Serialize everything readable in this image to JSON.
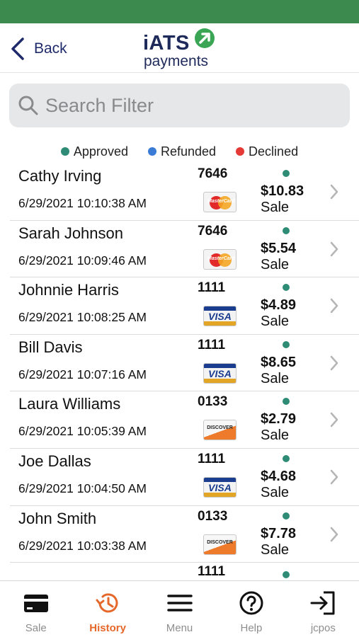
{
  "nav": {
    "back_label": "Back",
    "logo_line1": "iATS",
    "logo_line2": "payments"
  },
  "search": {
    "placeholder": "Search Filter"
  },
  "legend": [
    {
      "label": "Approved",
      "color": "#2e8b76"
    },
    {
      "label": "Refunded",
      "color": "#3a7bd5"
    },
    {
      "label": "Declined",
      "color": "#e53935"
    }
  ],
  "transactions": [
    {
      "name": "Cathy Irving",
      "date": "6/29/2021 10:10:38 AM",
      "last4": "7646",
      "card": "mastercard",
      "card_text": "MasterCard",
      "status": "approved",
      "amount": "$10.83",
      "type": "Sale"
    },
    {
      "name": "Sarah Johnson",
      "date": "6/29/2021 10:09:46 AM",
      "last4": "7646",
      "card": "mastercard",
      "card_text": "MasterCard",
      "status": "approved",
      "amount": "$5.54",
      "type": "Sale"
    },
    {
      "name": "Johnnie Harris",
      "date": "6/29/2021 10:08:25 AM",
      "last4": "1111",
      "card": "visa",
      "card_text": "VISA",
      "status": "approved",
      "amount": "$4.89",
      "type": "Sale"
    },
    {
      "name": "Bill Davis",
      "date": "6/29/2021 10:07:16 AM",
      "last4": "1111",
      "card": "visa",
      "card_text": "VISA",
      "status": "approved",
      "amount": "$8.65",
      "type": "Sale"
    },
    {
      "name": "Laura Williams",
      "date": "6/29/2021 10:05:39 AM",
      "last4": "0133",
      "card": "discover",
      "card_text": "DISCOVER",
      "status": "approved",
      "amount": "$2.79",
      "type": "Sale"
    },
    {
      "name": "Joe Dallas",
      "date": "6/29/2021 10:04:50 AM",
      "last4": "1111",
      "card": "visa",
      "card_text": "VISA",
      "status": "approved",
      "amount": "$4.68",
      "type": "Sale"
    },
    {
      "name": "John Smith",
      "date": "6/29/2021 10:03:38 AM",
      "last4": "0133",
      "card": "discover",
      "card_text": "DISCOVER",
      "status": "approved",
      "amount": "$7.78",
      "type": "Sale"
    }
  ],
  "partial_row": {
    "last4": "1111",
    "status": "approved"
  },
  "tabs": [
    {
      "label": "Sale",
      "icon": "card-icon",
      "active": false
    },
    {
      "label": "History",
      "icon": "history-icon",
      "active": true
    },
    {
      "label": "Menu",
      "icon": "menu-icon",
      "active": false
    },
    {
      "label": "Help",
      "icon": "help-icon",
      "active": false
    },
    {
      "label": "jcpos",
      "icon": "logout-icon",
      "active": false
    }
  ],
  "colors": {
    "status_bar": "#3d8a4e",
    "accent": "#e5672a",
    "approved": "#2e8b76"
  }
}
